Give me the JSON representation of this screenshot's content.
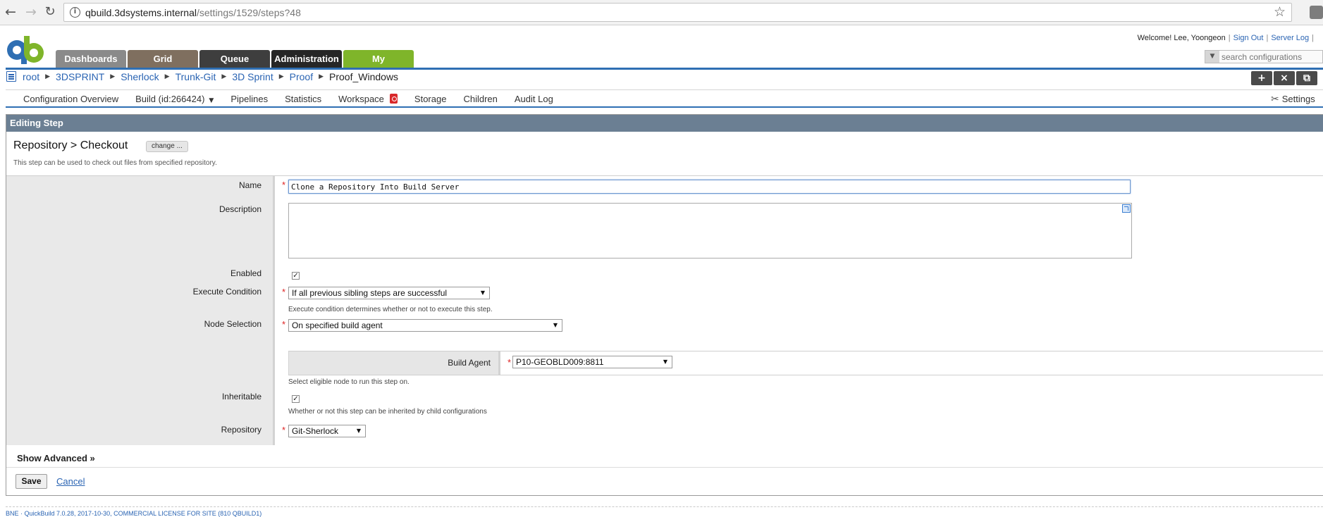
{
  "browser": {
    "url_host": "qbuild.3dsystems.internal",
    "url_path": "/settings/1529/steps?48"
  },
  "header": {
    "tabs": [
      {
        "label": "Dashboards"
      },
      {
        "label": "Grid"
      },
      {
        "label": "Queue"
      },
      {
        "label": "Administration"
      },
      {
        "label": "My"
      }
    ],
    "welcome": "Welcome! Lee, Yoongeon",
    "sign_out": "Sign Out",
    "server_log": "Server Log",
    "search_placeholder": "search configurations"
  },
  "breadcrumb": {
    "items": [
      "root",
      "3DSPRINT",
      "Sherlock",
      "Trunk-Git",
      "3D Sprint",
      "Proof"
    ],
    "current": "Proof_Windows"
  },
  "subnav": {
    "items": [
      "Configuration Overview",
      "Build (id:266424)",
      "Pipelines",
      "Statistics",
      "Workspace",
      "Storage",
      "Children",
      "Audit Log"
    ],
    "settings": "Settings"
  },
  "panel": {
    "header": "Editing Step",
    "step_title": "Repository > Checkout",
    "change_label": "change ...",
    "step_description": "This step can be used to check out files from specified repository."
  },
  "form": {
    "name_label": "Name",
    "name_value": "Clone a Repository Into Build Server",
    "description_label": "Description",
    "enabled_label": "Enabled",
    "enabled_checked": true,
    "execute_condition_label": "Execute Condition",
    "execute_condition_value": "If all previous sibling steps are successful",
    "execute_condition_hint": "Execute condition determines whether or not to execute this step.",
    "node_selection_label": "Node Selection",
    "node_selection_value": "On specified build agent",
    "build_agent_label": "Build Agent",
    "build_agent_value": "P10-GEOBLD009:8811",
    "node_selection_hint": "Select eligible node to run this step on.",
    "inheritable_label": "Inheritable",
    "inheritable_checked": true,
    "inheritable_hint": "Whether or not this step can be inherited by child configurations",
    "repository_label": "Repository",
    "repository_value": "Git-Sherlock",
    "required_mark": "*"
  },
  "actions": {
    "show_advanced": "Show Advanced »",
    "save": "Save",
    "cancel": "Cancel"
  },
  "footer": {
    "text": "BNE · QuickBuild 7.0.28, 2017-10-30, COMMERCIAL LICENSE FOR SITE (810 QBUILD1)"
  },
  "colors": {
    "accent_blue": "#2f6fb3",
    "link_blue": "#2a64b3",
    "tab_my_green": "#7fb52a",
    "panel_header": "#6b7f93",
    "required_red": "#d22222"
  },
  "icons": {
    "back": "arrow-left-icon",
    "forward": "arrow-right-icon",
    "reload": "reload-icon",
    "info": "info-icon",
    "star": "star-icon",
    "breadcrumb": "config-list-icon",
    "add": "plus-icon",
    "delete": "close-icon",
    "copy": "copy-icon",
    "settings": "tools-icon",
    "workspace": "workspace-lock-icon",
    "expand": "expand-editor-icon"
  }
}
